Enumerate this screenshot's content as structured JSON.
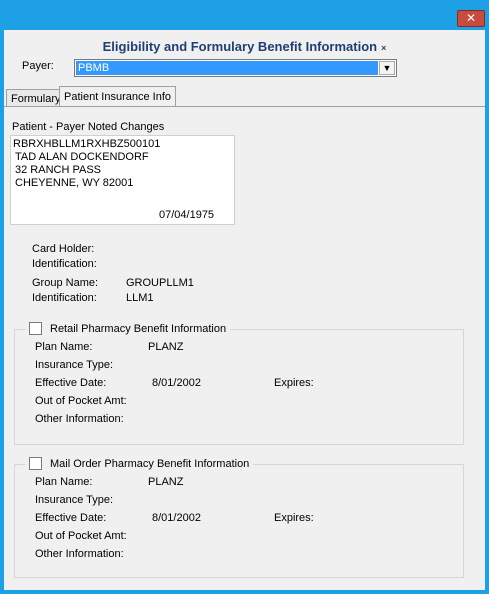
{
  "window": {
    "close_symbol": "✕"
  },
  "header": {
    "title": "Eligibility and Formulary Benefit Information",
    "marker": "×"
  },
  "payer": {
    "label": "Payer:",
    "value": "PBMB",
    "arrow": "▼"
  },
  "tabs": [
    {
      "label": "Formulary"
    },
    {
      "label": "Patient Insurance Info"
    }
  ],
  "patient": {
    "section_label": "Patient - Payer Noted Changes",
    "lines": [
      "RBRXHBLLM1RXHBZ500101",
      "TAD ALAN DOCKENDORF",
      "32 RANCH PASS",
      "CHEYENNE, WY   82001"
    ],
    "dob": "07/04/1975"
  },
  "cardholder": {
    "label1": "Card Holder:",
    "label2": "Identification:"
  },
  "group": {
    "name_label": "Group Name:",
    "name_value": "GROUPLLM1",
    "id_label": "Identification:",
    "id_value": "LLM1"
  },
  "retail": {
    "title": "Retail Pharmacy Benefit Information",
    "plan_label": "Plan Name:",
    "plan_value": "PLANZ",
    "insurance_label": "Insurance Type:",
    "effective_label": "Effective Date:",
    "effective_value": "8/01/2002",
    "expires_label": "Expires:",
    "oop_label": "Out of Pocket Amt:",
    "other_label": "Other Information:"
  },
  "mail": {
    "title": "Mail Order Pharmacy Benefit Information",
    "plan_label": "Plan Name:",
    "plan_value": "PLANZ",
    "insurance_label": "Insurance Type:",
    "effective_label": "Effective Date:",
    "effective_value": "8/01/2002",
    "expires_label": "Expires:",
    "oop_label": "Out of Pocket Amt:",
    "other_label": "Other Information:"
  }
}
